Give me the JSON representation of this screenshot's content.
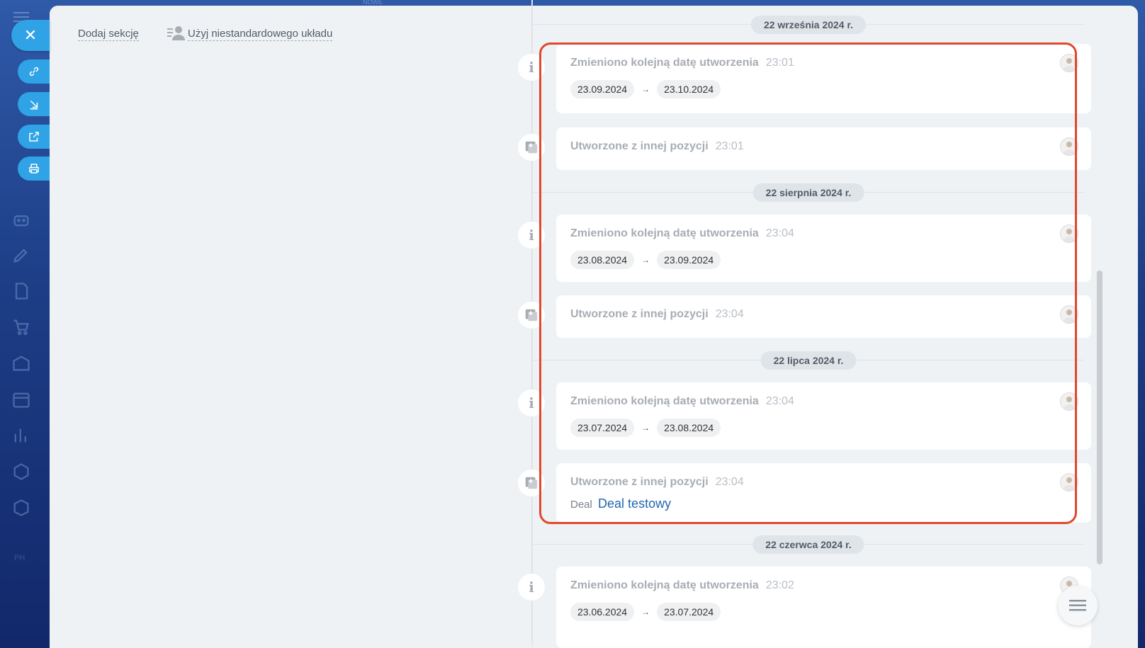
{
  "sidebar": {
    "badge": "PH",
    "top_label": "NOWE"
  },
  "side_actions": [
    {
      "name": "close",
      "icon": "close-icon"
    },
    {
      "name": "copy-link",
      "icon": "link-icon"
    },
    {
      "name": "download",
      "icon": "download-arrow-icon"
    },
    {
      "name": "open-new-window",
      "icon": "external-link-icon"
    },
    {
      "name": "print",
      "icon": "printer-icon"
    }
  ],
  "left_panel": {
    "add_section": "Dodaj sekcję",
    "custom_layout": "Użyj niestandardowego układu"
  },
  "timeline": {
    "groups": [
      {
        "date": "22 września 2024 r."
      },
      {
        "date": "22 sierpnia 2024 r."
      },
      {
        "date": "22 lipca 2024 r."
      },
      {
        "date": "22 czerwca 2024 r."
      }
    ],
    "items": [
      {
        "title": "Zmieniono kolejną datę utworzenia",
        "time": "23:01",
        "from": "23.09.2024",
        "to": "23.10.2024"
      },
      {
        "title": "Utworzone z innej pozycji",
        "time": "23:01"
      },
      {
        "title": "Zmieniono kolejną datę utworzenia",
        "time": "23:04",
        "from": "23.08.2024",
        "to": "23.09.2024"
      },
      {
        "title": "Utworzone z innej pozycji",
        "time": "23:04"
      },
      {
        "title": "Zmieniono kolejną datę utworzenia",
        "time": "23:04",
        "from": "23.07.2024",
        "to": "23.08.2024"
      },
      {
        "title": "Utworzone z innej pozycji",
        "time": "23:04",
        "entity_type": "Deal",
        "entity_link": "Deal testowy"
      },
      {
        "title": "Zmieniono kolejną datę utworzenia",
        "time": "23:02",
        "from": "23.06.2024",
        "to": "23.07.2024"
      }
    ],
    "arrow": "→"
  },
  "colors": {
    "accent": "#2fa3e6",
    "highlight": "#e0492e",
    "link": "#2067b0"
  }
}
